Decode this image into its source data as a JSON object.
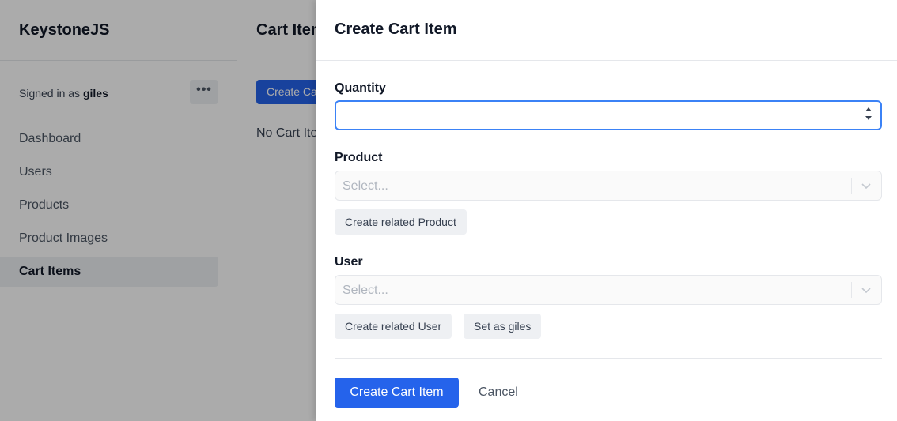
{
  "app": {
    "brand": "KeystoneJS",
    "signed_in_prefix": "Signed in as",
    "signed_in_user": "giles",
    "more_label": "•••",
    "nav": [
      {
        "label": "Dashboard",
        "active": false
      },
      {
        "label": "Users",
        "active": false
      },
      {
        "label": "Products",
        "active": false
      },
      {
        "label": "Product Images",
        "active": false
      },
      {
        "label": "Cart Items",
        "active": true
      }
    ],
    "main": {
      "title": "Cart Items",
      "create_button": "Create Cart Item",
      "empty_text": "No Cart Items found"
    }
  },
  "drawer": {
    "title": "Create Cart Item",
    "quantity": {
      "label": "Quantity",
      "value": ""
    },
    "product": {
      "label": "Product",
      "placeholder": "Select...",
      "create_related": "Create related Product"
    },
    "user": {
      "label": "User",
      "placeholder": "Select...",
      "create_related": "Create related User",
      "set_as": "Set as giles"
    },
    "submit": "Create Cart Item",
    "cancel": "Cancel"
  },
  "colors": {
    "primary": "#2563eb",
    "focus": "#3b82f6"
  }
}
